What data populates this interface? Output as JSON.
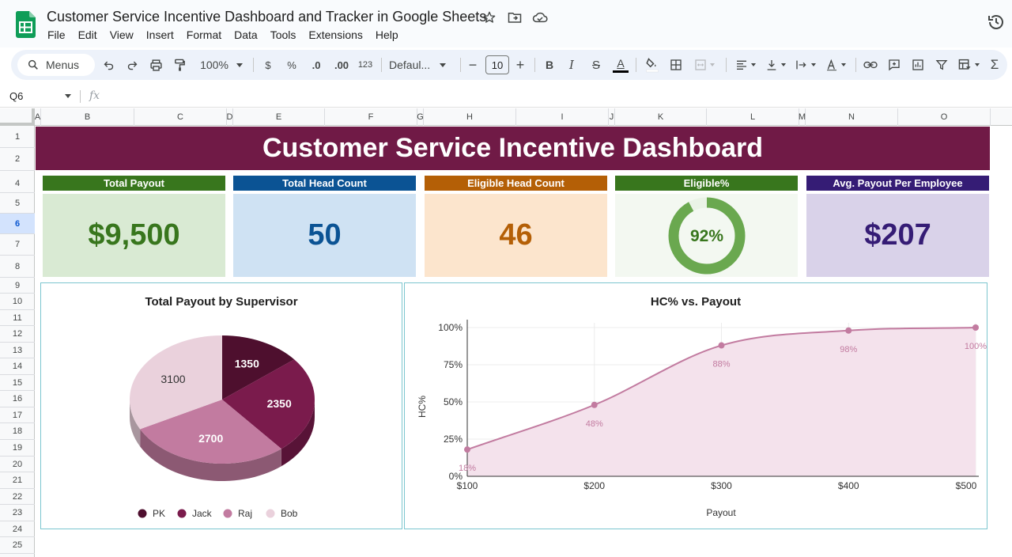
{
  "window": {
    "doc_title": "Customer Service Incentive Dashboard and Tracker in Google Sheets",
    "menu": [
      "File",
      "Edit",
      "View",
      "Insert",
      "Format",
      "Data",
      "Tools",
      "Extensions",
      "Help"
    ]
  },
  "toolbar": {
    "menus_label": "Menus",
    "zoom": "100%",
    "currency": "$",
    "percent": "%",
    "dec_decrease": ".0",
    "dec_increase": ".00",
    "number_format": "123",
    "font": "Defaul...",
    "font_size": "10",
    "minus": "−",
    "plus": "+",
    "bold": "B",
    "italic": "I",
    "strike": "S",
    "text_color": "A",
    "text_color_swatch": "#000000"
  },
  "formula_bar": {
    "cell_ref": "Q6",
    "fx": "fx"
  },
  "columns": [
    "A",
    "B",
    "C",
    "D",
    "E",
    "F",
    "G",
    "H",
    "I",
    "J",
    "K",
    "L",
    "M",
    "N",
    "O"
  ],
  "rows": [
    "1",
    "2",
    "4",
    "5",
    "6",
    "7",
    "8",
    "9",
    "10",
    "11",
    "12",
    "13",
    "14",
    "15",
    "16",
    "17",
    "18",
    "19",
    "20",
    "21",
    "22",
    "23",
    "24",
    "25"
  ],
  "active_row": "6",
  "dashboard": {
    "title": "Customer Service Incentive Dashboard",
    "title_bg": "#701a46",
    "kpis": [
      {
        "label": "Total Payout",
        "value": "$9,500",
        "head_color": "#38761d",
        "body_color": "#d9ead3",
        "text_color": "#38761d"
      },
      {
        "label": "Total Head Count",
        "value": "50",
        "head_color": "#0b5394",
        "body_color": "#cfe2f3",
        "text_color": "#0b5394"
      },
      {
        "label": "Eligible Head Count",
        "value": "46",
        "head_color": "#b45f06",
        "body_color": "#fce5cd",
        "text_color": "#b45f06"
      },
      {
        "label": "Eligible%",
        "value": "92%",
        "percent": 0.92,
        "head_color": "#38761d",
        "body_color": "#f3f8f1",
        "text_color": "#38761d",
        "ring_color": "#6aa84f",
        "ring_track": "#eaf3e6"
      },
      {
        "label": "Avg. Payout Per Employee",
        "value": "$207",
        "head_color": "#351c75",
        "body_color": "#d9d2e9",
        "text_color": "#351c75"
      }
    ]
  },
  "chart_data": [
    {
      "type": "pie",
      "title": "Total Payout by Supervisor",
      "categories": [
        "PK",
        "Jack",
        "Raj",
        "Bob"
      ],
      "values": [
        1350,
        2350,
        2700,
        3100
      ],
      "labels": [
        "1350",
        "2350",
        "2700",
        "3100"
      ],
      "colors": [
        "#4e0f2e",
        "#7a1b4c",
        "#c27ba0",
        "#ead1dc"
      ],
      "label_colors": [
        "#ffffff",
        "#ffffff",
        "#ffffff",
        "#333333"
      ],
      "legend_position": "bottom"
    },
    {
      "type": "area",
      "title": "HC% vs. Payout",
      "x": [
        100,
        200,
        300,
        400,
        500
      ],
      "y": [
        18,
        48,
        88,
        98,
        100
      ],
      "point_labels": [
        "18%",
        "48%",
        "88%",
        "98%",
        "100%"
      ],
      "x_tick_labels": [
        "$100",
        "$200",
        "$300",
        "$400",
        "$500"
      ],
      "y_tick_labels": [
        "0%",
        "25%",
        "50%",
        "75%",
        "100%"
      ],
      "y_ticks": [
        0,
        25,
        50,
        75,
        100
      ],
      "xlabel": "Payout",
      "ylabel": "HC%",
      "xlim": [
        100,
        500
      ],
      "ylim": [
        0,
        100
      ],
      "line_color": "#c27ba0",
      "fill_color": "#f4e2ec",
      "grid": true
    }
  ]
}
